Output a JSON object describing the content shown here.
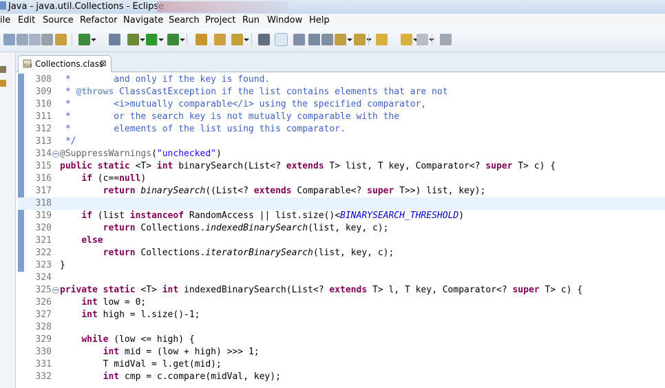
{
  "window": {
    "title": "Java - java.util.Collections - Eclipse"
  },
  "menu": [
    "ile",
    "Edit",
    "Source",
    "Refactor",
    "Navigate",
    "Search",
    "Project",
    "Run",
    "Window",
    "Help"
  ],
  "editor_tab": {
    "label": "Collections.class",
    "close_glyph": "⊠"
  },
  "code_lines": [
    {
      "n": "308",
      "segs": [
        [
          "cm",
          " *        and only if the key is found."
        ]
      ]
    },
    {
      "n": "309",
      "segs": [
        [
          "cm",
          " * "
        ],
        [
          "tg",
          "@throws"
        ],
        [
          "cm",
          " ClassCastException if the list contains elements that are not"
        ]
      ]
    },
    {
      "n": "310",
      "segs": [
        [
          "cm",
          " *        <i>mutually comparable</i> using the specified comparator,"
        ]
      ]
    },
    {
      "n": "311",
      "segs": [
        [
          "cm",
          " *        or the search key is not mutually comparable with the"
        ]
      ]
    },
    {
      "n": "312",
      "segs": [
        [
          "cm",
          " *        elements of the list using this comparator."
        ]
      ]
    },
    {
      "n": "313",
      "segs": [
        [
          "cm",
          " */"
        ]
      ]
    },
    {
      "n": "314",
      "fold": true,
      "segs": [
        [
          "an",
          "@SuppressWarnings"
        ],
        [
          "",
          "("
        ],
        [
          "st",
          "\"unchecked\""
        ],
        [
          "",
          ")"
        ]
      ]
    },
    {
      "n": "315",
      "segs": [
        [
          "kw",
          "public static"
        ],
        [
          "",
          " <T> "
        ],
        [
          "kw",
          "int"
        ],
        [
          "",
          " binarySearch(List<? "
        ],
        [
          "kw",
          "extends"
        ],
        [
          "",
          " T> list, T key, Comparator<? "
        ],
        [
          "kw",
          "super"
        ],
        [
          "",
          " T> c) {"
        ]
      ]
    },
    {
      "n": "316",
      "segs": [
        [
          "",
          "    "
        ],
        [
          "kw",
          "if"
        ],
        [
          "",
          " (c=="
        ],
        [
          "kw",
          "null"
        ],
        [
          "",
          ")"
        ]
      ]
    },
    {
      "n": "317",
      "segs": [
        [
          "",
          "        "
        ],
        [
          "kw",
          "return"
        ],
        [
          "",
          " "
        ],
        [
          "it",
          "binarySearch"
        ],
        [
          "",
          "((List<? "
        ],
        [
          "kw",
          "extends"
        ],
        [
          "",
          " Comparable<? "
        ],
        [
          "kw",
          "super"
        ],
        [
          "",
          " T>>) list, key);"
        ]
      ]
    },
    {
      "n": "318",
      "cur": true,
      "segs": []
    },
    {
      "n": "319",
      "segs": [
        [
          "",
          "    "
        ],
        [
          "kw",
          "if"
        ],
        [
          "",
          " (list "
        ],
        [
          "kw",
          "instanceof"
        ],
        [
          "",
          " RandomAccess || list.size()<"
        ],
        [
          "sf",
          "BINARYSEARCH_THRESHOLD"
        ],
        [
          "",
          ")"
        ]
      ]
    },
    {
      "n": "320",
      "segs": [
        [
          "",
          "        "
        ],
        [
          "kw",
          "return"
        ],
        [
          "",
          " Collections."
        ],
        [
          "it",
          "indexedBinarySearch"
        ],
        [
          "",
          "(list, key, c);"
        ]
      ]
    },
    {
      "n": "321",
      "segs": [
        [
          "",
          "    "
        ],
        [
          "kw",
          "else"
        ]
      ]
    },
    {
      "n": "322",
      "segs": [
        [
          "",
          "        "
        ],
        [
          "kw",
          "return"
        ],
        [
          "",
          " Collections."
        ],
        [
          "it",
          "iteratorBinarySearch"
        ],
        [
          "",
          "(list, key, c);"
        ]
      ]
    },
    {
      "n": "323",
      "segs": [
        [
          "",
          "}"
        ]
      ]
    },
    {
      "n": "324",
      "segs": []
    },
    {
      "n": "325",
      "fold": true,
      "segs": [
        [
          "kw",
          "private static"
        ],
        [
          "",
          " <T> "
        ],
        [
          "kw",
          "int"
        ],
        [
          "",
          " indexedBinarySearch(List<? "
        ],
        [
          "kw",
          "extends"
        ],
        [
          "",
          " T> l, T key, Comparator<? "
        ],
        [
          "kw",
          "super"
        ],
        [
          "",
          " T> c) {"
        ]
      ]
    },
    {
      "n": "326",
      "segs": [
        [
          "",
          "    "
        ],
        [
          "kw",
          "int"
        ],
        [
          "",
          " low = 0;"
        ]
      ]
    },
    {
      "n": "327",
      "segs": [
        [
          "",
          "    "
        ],
        [
          "kw",
          "int"
        ],
        [
          "",
          " high = l.size()-1;"
        ]
      ]
    },
    {
      "n": "328",
      "segs": []
    },
    {
      "n": "329",
      "segs": [
        [
          "",
          "    "
        ],
        [
          "kw",
          "while"
        ],
        [
          "",
          " (low <= high) {"
        ]
      ]
    },
    {
      "n": "330",
      "segs": [
        [
          "",
          "        "
        ],
        [
          "kw",
          "int"
        ],
        [
          "",
          " mid = (low + high) >>> 1;"
        ]
      ]
    },
    {
      "n": "331",
      "segs": [
        [
          "",
          "        T midVal = l.get(mid);"
        ]
      ]
    },
    {
      "n": "332",
      "segs": [
        [
          "",
          "        "
        ],
        [
          "kw",
          "int"
        ],
        [
          "",
          " cmp = c.compare(midVal, key);"
        ]
      ]
    }
  ],
  "toolbar_icons": [
    {
      "name": "new-icon",
      "color": "#8aa0c0",
      "dd": true
    },
    {
      "name": "save-icon",
      "color": "#9aa8bc"
    },
    {
      "name": "save-all-icon",
      "color": "#a8b4c6"
    },
    {
      "name": "print-icon",
      "color": "#98a0aa"
    },
    {
      "name": "new-package-icon",
      "color": "#c8a040"
    },
    {
      "name": "new-class-icon",
      "color": "#3c8a3c",
      "dd": true
    },
    {
      "name": "skip-breakpoints-icon",
      "color": "#7080a0"
    },
    {
      "name": "debug-icon",
      "color": "#6a8a3a",
      "dd": true
    },
    {
      "name": "run-icon",
      "color": "#2e9a2e",
      "dd": true
    },
    {
      "name": "run-external-tools-icon",
      "color": "#3a8a3a",
      "dd": true
    },
    {
      "name": "open-type-icon",
      "color": "#c89830"
    },
    {
      "name": "open-task-icon",
      "color": "#d0a040"
    },
    {
      "name": "search-icon",
      "color": "#c8a038",
      "dd": true
    },
    {
      "name": "next-annotation-icon",
      "color": "#607080"
    },
    {
      "name": "toggle-mark-occurrences-icon",
      "color": "#e0c040",
      "sel": true
    },
    {
      "name": "toggle-block-selection-icon",
      "color": "#8090a8"
    },
    {
      "name": "show-whitespace-icon",
      "color": "#7a8aa0"
    },
    {
      "name": "breadcrumb-icon",
      "color": "#8090a0"
    },
    {
      "name": "next-edit-icon",
      "color": "#c0a040",
      "dd": true
    },
    {
      "name": "previous-edit-icon",
      "color": "#c0a040",
      "dd": true
    },
    {
      "name": "last-edit-location-icon",
      "color": "#d8b040"
    },
    {
      "name": "back-icon",
      "color": "#d8b040",
      "dd": true
    },
    {
      "name": "forward-icon",
      "color": "#b8bcc4",
      "dd": true
    },
    {
      "name": "pin-editor-icon",
      "color": "#a0a8b4"
    }
  ]
}
